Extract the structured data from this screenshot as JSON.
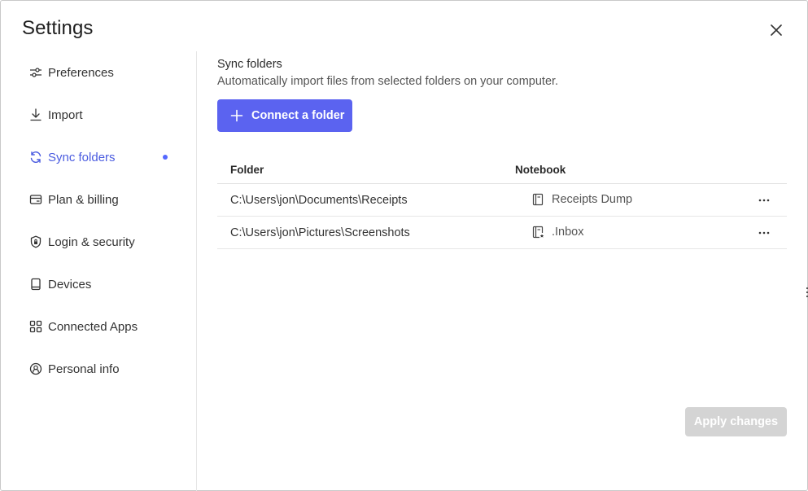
{
  "dialog": {
    "title": "Settings"
  },
  "sidebar": {
    "items": [
      {
        "label": "Preferences",
        "icon": "sliders-icon"
      },
      {
        "label": "Import",
        "icon": "download-icon"
      },
      {
        "label": "Sync folders",
        "icon": "sync-icon",
        "active": true
      },
      {
        "label": "Plan & billing",
        "icon": "credit-card-icon"
      },
      {
        "label": "Login & security",
        "icon": "shield-lock-icon"
      },
      {
        "label": "Devices",
        "icon": "tablet-icon"
      },
      {
        "label": "Connected Apps",
        "icon": "apps-grid-icon"
      },
      {
        "label": "Personal info",
        "icon": "user-circle-icon"
      }
    ]
  },
  "main": {
    "section_title": "Sync folders",
    "section_description": "Automatically import files from selected folders on your computer.",
    "connect_button_label": "Connect a folder",
    "table": {
      "headers": {
        "folder": "Folder",
        "notebook": "Notebook"
      },
      "rows": [
        {
          "folder": "C:\\Users\\jon\\Documents\\Receipts",
          "notebook": "Receipts Dump",
          "notebook_icon": "notebook-icon"
        },
        {
          "folder": "C:\\Users\\jon\\Pictures\\Screenshots",
          "notebook": ".Inbox",
          "notebook_icon": "inbox-notebook-icon"
        }
      ]
    },
    "apply_button_label": "Apply changes"
  },
  "colors": {
    "accent": "#5b63f0",
    "active_text": "#4b5ce0",
    "disabled_button": "#d4d4d4"
  }
}
